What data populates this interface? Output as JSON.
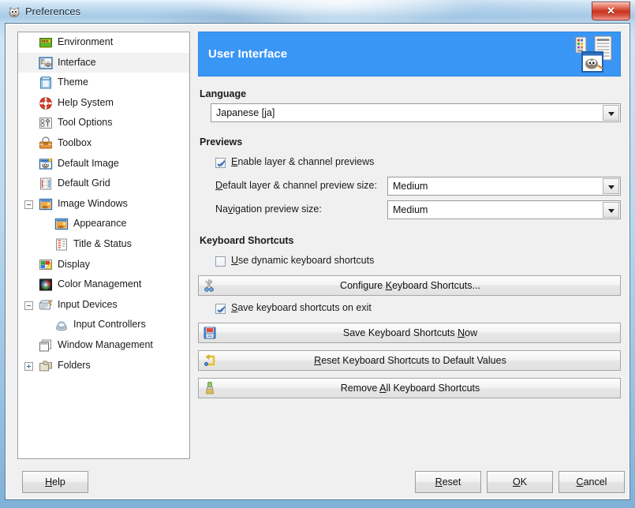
{
  "window": {
    "title": "Preferences",
    "title_icon": "gimp-wilber-icon",
    "close_label": "✕"
  },
  "sidebar": {
    "items": [
      {
        "label": "Environment",
        "icon": "environment-icon",
        "level": 0,
        "selected": false,
        "expander": null
      },
      {
        "label": "Interface",
        "icon": "interface-icon",
        "level": 0,
        "selected": true,
        "expander": null
      },
      {
        "label": "Theme",
        "icon": "theme-icon",
        "level": 0,
        "selected": false,
        "expander": null
      },
      {
        "label": "Help System",
        "icon": "help-system-icon",
        "level": 0,
        "selected": false,
        "expander": null
      },
      {
        "label": "Tool Options",
        "icon": "tool-options-icon",
        "level": 0,
        "selected": false,
        "expander": null
      },
      {
        "label": "Toolbox",
        "icon": "toolbox-icon",
        "level": 0,
        "selected": false,
        "expander": null
      },
      {
        "label": "Default Image",
        "icon": "default-image-icon",
        "level": 0,
        "selected": false,
        "expander": null
      },
      {
        "label": "Default Grid",
        "icon": "default-grid-icon",
        "level": 0,
        "selected": false,
        "expander": null
      },
      {
        "label": "Image Windows",
        "icon": "image-windows-icon",
        "level": 0,
        "selected": false,
        "expander": "minus"
      },
      {
        "label": "Appearance",
        "icon": "appearance-icon",
        "level": 1,
        "selected": false,
        "expander": null
      },
      {
        "label": "Title & Status",
        "icon": "title-status-icon",
        "level": 1,
        "selected": false,
        "expander": null
      },
      {
        "label": "Display",
        "icon": "display-icon",
        "level": 0,
        "selected": false,
        "expander": null
      },
      {
        "label": "Color Management",
        "icon": "color-management-icon",
        "level": 0,
        "selected": false,
        "expander": null
      },
      {
        "label": "Input Devices",
        "icon": "input-devices-icon",
        "level": 0,
        "selected": false,
        "expander": "minus"
      },
      {
        "label": "Input Controllers",
        "icon": "input-controllers-icon",
        "level": 1,
        "selected": false,
        "expander": null
      },
      {
        "label": "Window Management",
        "icon": "window-management-icon",
        "level": 0,
        "selected": false,
        "expander": null
      },
      {
        "label": "Folders",
        "icon": "folders-icon",
        "level": 0,
        "selected": false,
        "expander": "plus"
      }
    ]
  },
  "banner": {
    "title": "User Interface",
    "color": "#3a96f5"
  },
  "language": {
    "section_title": "Language",
    "value": "Japanese [ja]"
  },
  "previews": {
    "section_title": "Previews",
    "enable_checkbox": {
      "label": "Enable layer & channel previews",
      "mnemonic": "E",
      "checked": true
    },
    "default_size": {
      "label": "Default layer & channel preview size:",
      "mnemonic": "D",
      "value": "Medium"
    },
    "navigation_size": {
      "label": "Navigation preview size:",
      "mnemonic": "v",
      "value": "Medium"
    }
  },
  "keyboard_shortcuts": {
    "section_title": "Keyboard Shortcuts",
    "use_dynamic": {
      "label": "Use dynamic keyboard shortcuts",
      "mnemonic": "U",
      "checked": false
    },
    "save_on_exit": {
      "label": "Save keyboard shortcuts on exit",
      "mnemonic": "S",
      "checked": true
    },
    "buttons": [
      {
        "label": "Configure Keyboard Shortcuts...",
        "icon": "configure-shortcuts-icon"
      },
      {
        "label": "Save Keyboard Shortcuts Now",
        "icon": "save-floppy-icon"
      },
      {
        "label": "Reset Keyboard Shortcuts to Default Values",
        "icon": "reset-arrow-icon"
      },
      {
        "label": "Remove All Keyboard Shortcuts",
        "icon": "paintbrush-clear-icon"
      }
    ]
  },
  "footer": {
    "help": "Help",
    "reset": "Reset",
    "ok": "OK",
    "cancel": "Cancel"
  }
}
